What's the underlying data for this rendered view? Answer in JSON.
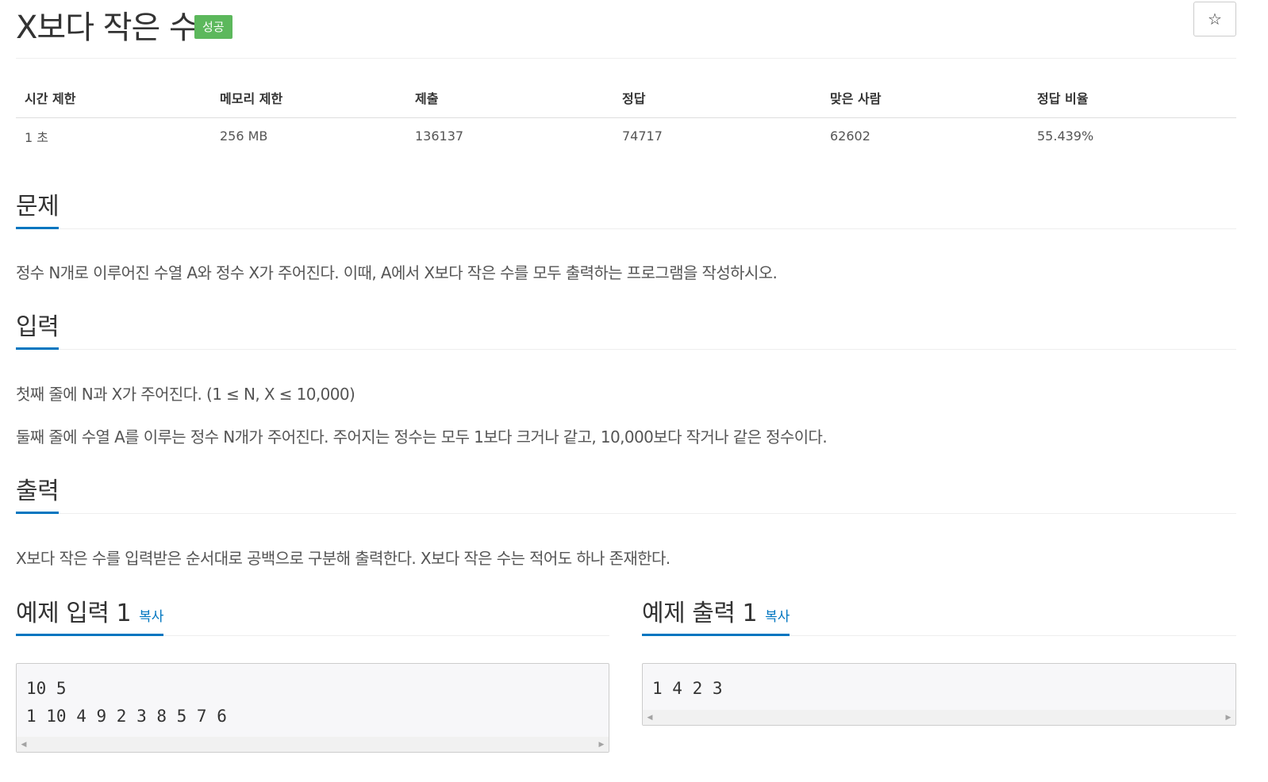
{
  "header": {
    "title": "X보다 작은 수",
    "badge": "성공",
    "star": "☆"
  },
  "info_table": {
    "headers": [
      "시간 제한",
      "메모리 제한",
      "제출",
      "정답",
      "맞은 사람",
      "정답 비율"
    ],
    "values": [
      "1 초",
      "256 MB",
      "136137",
      "74717",
      "62602",
      "55.439%"
    ]
  },
  "sections": {
    "problem": {
      "title": "문제",
      "text": "정수 N개로 이루어진 수열 A와 정수 X가 주어진다. 이때, A에서 X보다 작은 수를 모두 출력하는 프로그램을 작성하시오."
    },
    "input": {
      "title": "입력",
      "line1": "첫째 줄에 N과 X가 주어진다. (1 ≤ N, X ≤ 10,000)",
      "line2": "둘째 줄에 수열 A를 이루는 정수 N개가 주어진다. 주어지는 정수는 모두 1보다 크거나 같고, 10,000보다 작거나 같은 정수이다."
    },
    "output": {
      "title": "출력",
      "text": "X보다 작은 수를 입력받은 순서대로 공백으로 구분해 출력한다. X보다 작은 수는 적어도 하나 존재한다."
    }
  },
  "samples": {
    "input": {
      "title": "예제 입력 1",
      "copy": "복사",
      "content": "10 5\n1 10 4 9 2 3 8 5 7 6"
    },
    "output": {
      "title": "예제 출력 1",
      "copy": "복사",
      "content": "1 4 2 3"
    }
  },
  "colors": {
    "success_badge": "#5cb85c",
    "link": "#0076c0",
    "sample_bg": "#f7f7f9"
  },
  "icons": {
    "star": "star-icon",
    "scroll_left": "arrow-left-icon",
    "scroll_right": "arrow-right-icon"
  }
}
